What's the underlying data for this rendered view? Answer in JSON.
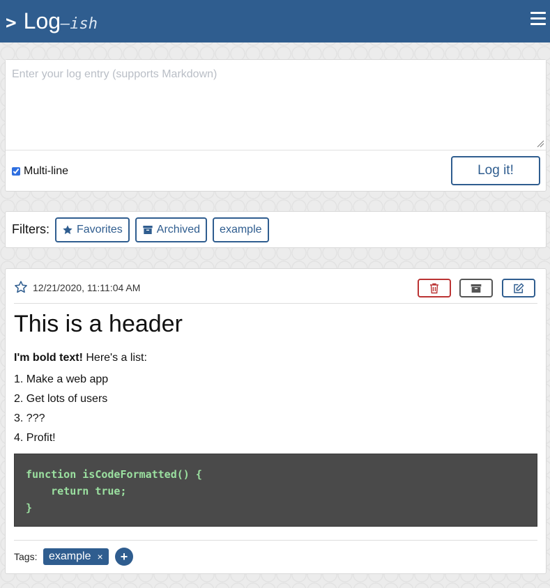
{
  "header": {
    "prompt": ">",
    "title": "Log",
    "suffix": "—ish"
  },
  "entry": {
    "placeholder": "Enter your log entry (supports Markdown)",
    "multiline_label": "Multi-line",
    "submit_label": "Log it!"
  },
  "filters": {
    "label": "Filters:",
    "items": [
      {
        "label": "Favorites",
        "icon": "star-icon"
      },
      {
        "label": "Archived",
        "icon": "archive-icon"
      },
      {
        "label": "example"
      }
    ]
  },
  "log": {
    "timestamp": "12/21/2020, 11:11:04 AM",
    "heading": "This is a header",
    "bold": "I'm bold text!",
    "text": " Here's a list:",
    "list": [
      "1. Make a web app",
      "2. Get lots of users",
      "3. ???",
      "4. Profit!"
    ],
    "code": [
      "function isCodeFormatted() {",
      "    return true;",
      "}"
    ],
    "tags_label": "Tags:",
    "tags": [
      {
        "label": "example",
        "remove": "×"
      }
    ],
    "add_tag": "+"
  },
  "colors": {
    "accent": "#2f5d8f",
    "danger": "#b33333",
    "code_bg": "#4a4a4a",
    "code_text": "#9be0a0"
  }
}
